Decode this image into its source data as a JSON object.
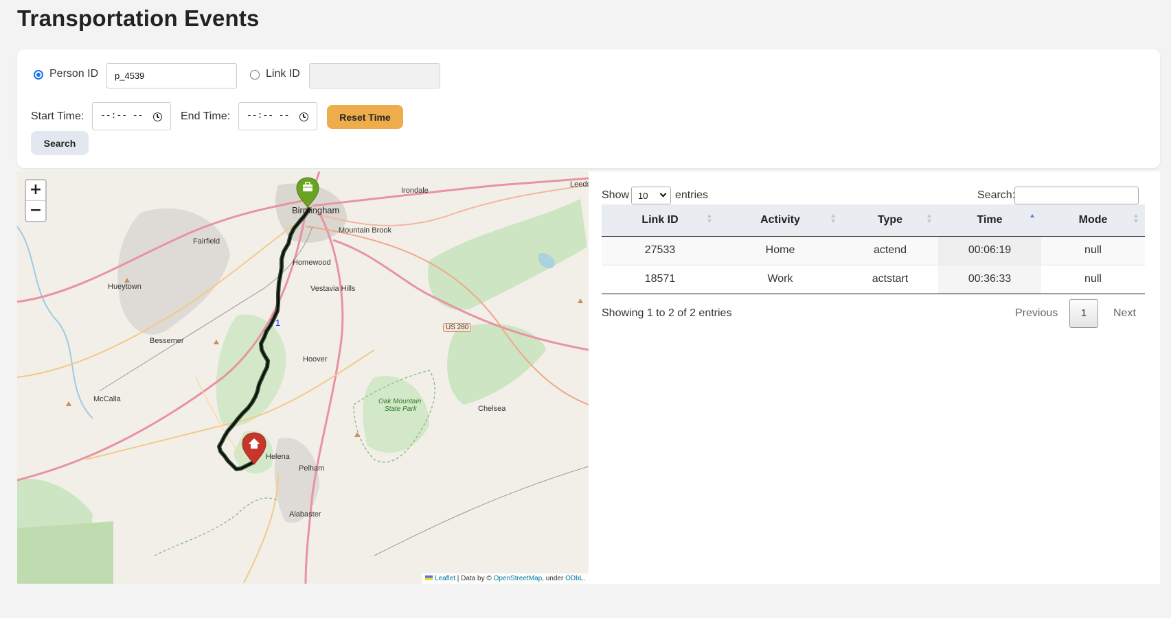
{
  "page": {
    "title": "Transportation Events"
  },
  "form": {
    "person_id_label": "Person ID",
    "person_id_value": "p_4539",
    "person_id_selected": true,
    "link_id_label": "Link ID",
    "link_id_value": "",
    "start_time_label": "Start Time:",
    "start_time_value": "--:-- --",
    "end_time_label": "End Time:",
    "end_time_value": "--:-- --",
    "reset_button": "Reset Time",
    "search_button": "Search"
  },
  "map": {
    "zoom_in": "+",
    "zoom_out": "−",
    "attribution": {
      "leaflet": "Leaflet",
      "data_by": "| Data by ©",
      "osm": "OpenStreetMap",
      "under": ", under",
      "odbl": "ODbL",
      "period": "."
    },
    "places": {
      "birmingham": "Birmingham",
      "irondale": "Irondale",
      "leeds": "Leeds",
      "fairfield": "Fairfield",
      "mountain_brook": "Mountain Brook",
      "homewood": "Homewood",
      "hueytown": "Hueytown",
      "vestavia_hills": "Vestavia Hills",
      "bessemer": "Bessemer",
      "hoover": "Hoover",
      "mccalla": "McCalla",
      "chelsea": "Chelsea",
      "oak_mountain": "Oak Mountain",
      "state_park": "State Park",
      "helena": "Helena",
      "pelham": "Pelham",
      "alabaster": "Alabaster",
      "us280": "US 280"
    },
    "route_label": "1",
    "icons": {
      "work_marker": "briefcase-icon",
      "home_marker": "home-icon"
    }
  },
  "table": {
    "show_label": "Show",
    "entries_label": "entries",
    "page_length": "10",
    "search_label": "Search:",
    "search_value": "",
    "columns": [
      "Link ID",
      "Activity",
      "Type",
      "Time",
      "Mode"
    ],
    "sorted_column": "Time",
    "rows": [
      [
        "27533",
        "Home",
        "actend",
        "00:06:19",
        "null"
      ],
      [
        "18571",
        "Work",
        "actstart",
        "00:36:33",
        "null"
      ]
    ],
    "info": "Showing 1 to 2 of 2 entries",
    "previous": "Previous",
    "current_page": "1",
    "next": "Next"
  },
  "colors": {
    "accent": "#efac4b",
    "radio": "#1a73e8",
    "route": "#0a3d0a",
    "work_marker": "#6aa321",
    "home_marker": "#c8352a"
  }
}
